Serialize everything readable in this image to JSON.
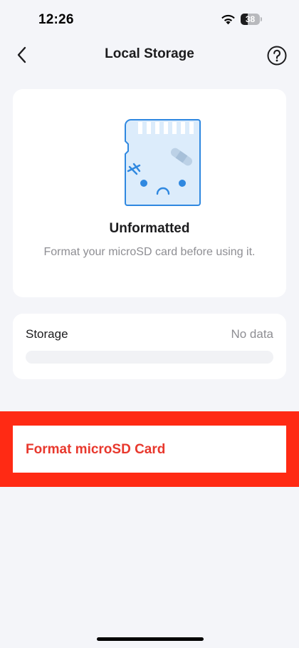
{
  "status_bar": {
    "time": "12:26",
    "battery_level": "38",
    "battery_fraction": 0.38
  },
  "nav": {
    "title": "Local Storage",
    "back_icon": "chevron-left-icon",
    "help_icon": "question-circle-icon"
  },
  "status_card": {
    "illustration": "sad-microsd-card-icon",
    "heading": "Unformatted",
    "description": "Format your microSD card before using it."
  },
  "storage": {
    "label": "Storage",
    "value": "No data",
    "usage_fraction": 0
  },
  "format": {
    "label": "Format microSD Card"
  },
  "colors": {
    "background": "#f4f5f9",
    "card": "#ffffff",
    "title_text": "#1c1c1e",
    "secondary_text": "#8e8e93",
    "danger_text": "#e8382d",
    "highlight": "#ff2a14",
    "illustration_blue": "#2f88e0",
    "illustration_fill": "#dcecfb"
  }
}
